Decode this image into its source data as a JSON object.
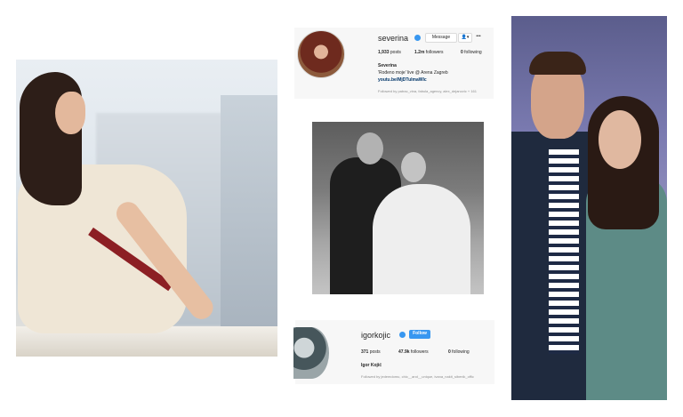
{
  "top_profile": {
    "username": "severina",
    "message_button": "Message",
    "follow_dropdown": "▾",
    "more": "•••",
    "posts": "1,933",
    "posts_label": "posts",
    "followers": "1.2m",
    "followers_label": "followers",
    "following": "0",
    "following_label": "following",
    "full_name": "Severina",
    "bio": "'Rođeno moje' live @ Arena Zagreb",
    "link": "youtu.be/MjDTulmaWlc",
    "followed_by": "Followed by patrac_vina, fabula_agency, alex_dejanovic + 161"
  },
  "bottom_profile": {
    "username": "igorkojic",
    "follow_button": "Follow",
    "posts": "371",
    "posts_label": "posts",
    "followers": "47.9k",
    "followers_label": "followers",
    "following": "0",
    "following_label": "following",
    "full_name": "Igor Kojić",
    "followed_by": "Followed by jedemdomu, chic__and__unique, ivana_nakit_sibenik_offic"
  },
  "colors": {
    "verified": "#3897f0",
    "follow_button": "#3897f0",
    "link": "#003569"
  }
}
